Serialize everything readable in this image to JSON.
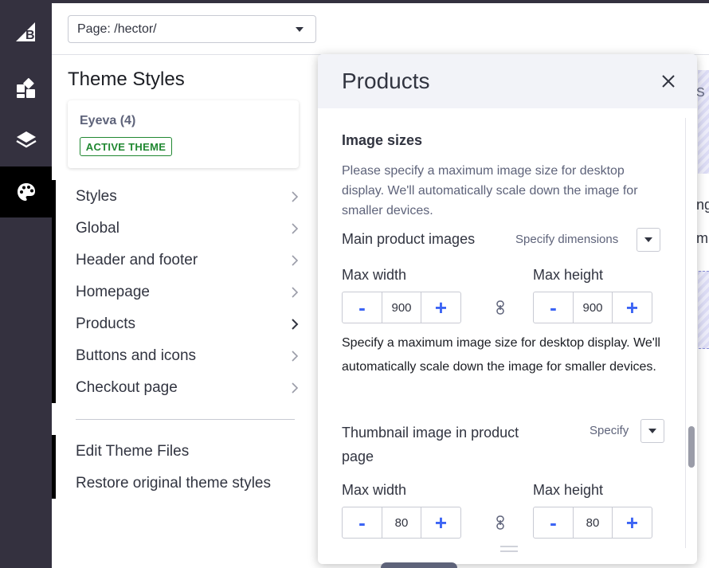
{
  "page_select": {
    "value": "Page: /hector/"
  },
  "rail": {
    "items": [
      "bigcommerce-logo",
      "dashboard-icon",
      "layers-icon",
      "palette-icon"
    ]
  },
  "theme": {
    "title": "Theme Styles",
    "name": "Eyeva (4)",
    "badge": "ACTIVE THEME"
  },
  "nav": {
    "items": [
      {
        "label": "Styles"
      },
      {
        "label": "Global"
      },
      {
        "label": "Header and footer"
      },
      {
        "label": "Homepage"
      },
      {
        "label": "Products"
      },
      {
        "label": "Buttons and icons"
      },
      {
        "label": "Checkout page"
      }
    ],
    "edit_files": "Edit Theme Files",
    "restore": "Restore original theme styles"
  },
  "preview": {
    "snippets": [
      "S",
      "ng",
      "m"
    ]
  },
  "panel": {
    "title": "Products",
    "section_title": "Image sizes",
    "section_desc": "Please specify a maximum image size for desktop display. We'll automatically scale down the image for smaller devices.",
    "main_images": {
      "label": "Main product images",
      "dimension_mode": "Specify dimensions",
      "max_width_label": "Max width",
      "max_height_label": "Max height",
      "width": "900",
      "height": "900",
      "help": "Specify a maximum image size for desktop display. We'll automatically scale down the image for smaller devices."
    },
    "thumbnail": {
      "label": "Thumbnail image in product page",
      "dimension_mode": "Specify",
      "max_width_label": "Max width",
      "max_height_label": "Max height",
      "width": "80",
      "height": "80"
    },
    "minus": "-",
    "plus": "+"
  },
  "colors": {
    "rail_bg": "#34313f",
    "accent_blue": "#3c64f4",
    "active_green": "#208831"
  }
}
